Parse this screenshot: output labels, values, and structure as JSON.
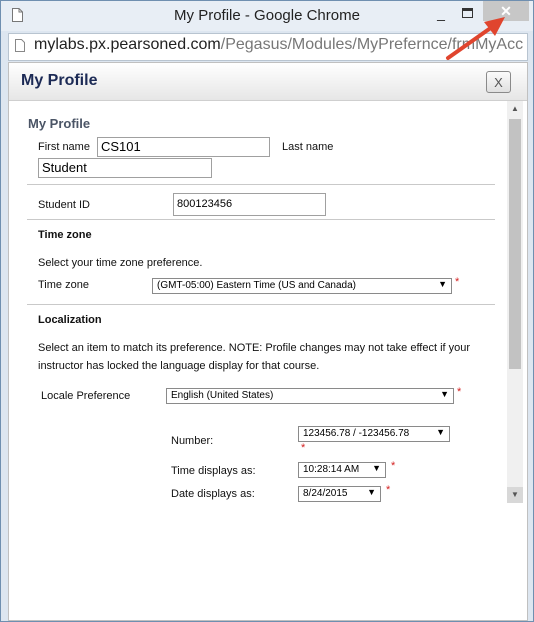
{
  "window": {
    "title": "My Profile - Google Chrome",
    "minimize_label": "_",
    "close_label": "✕"
  },
  "address": {
    "domain": "mylabs.px.pearsoned.com",
    "path": "/Pegasus/Modules/MyPrefernce/frmMyAcc"
  },
  "dialog": {
    "title": "My Profile",
    "close_label": "X"
  },
  "profile": {
    "heading": "My Profile",
    "first_name_label": "First name",
    "first_name_value": "CS101",
    "last_name_label": "Last name",
    "last_name_value": "Student",
    "student_id_label": "Student ID",
    "student_id_value": "800123456"
  },
  "timezone": {
    "heading": "Time zone",
    "description": "Select your time zone preference.",
    "label": "Time zone",
    "selected": "(GMT-05:00) Eastern Time (US and Canada)"
  },
  "localization": {
    "heading": "Localization",
    "description_line1": "Select an item to match its preference. NOTE: Profile changes may not take effect if your",
    "description_line2": "instructor has locked the language display for that course.",
    "locale_label": "Locale Preference",
    "locale_selected": "English (United States)",
    "number_label": "Number:",
    "number_selected": "123456.78 / -123456.78",
    "time_label": "Time displays as:",
    "time_selected": "10:28:14 AM",
    "date_label": "Date displays as:",
    "date_selected": "8/24/2015"
  },
  "required_marker": "*",
  "colors": {
    "dialog_title": "#1c2a55",
    "required": "#d42020",
    "arrow": "#e0452e"
  }
}
